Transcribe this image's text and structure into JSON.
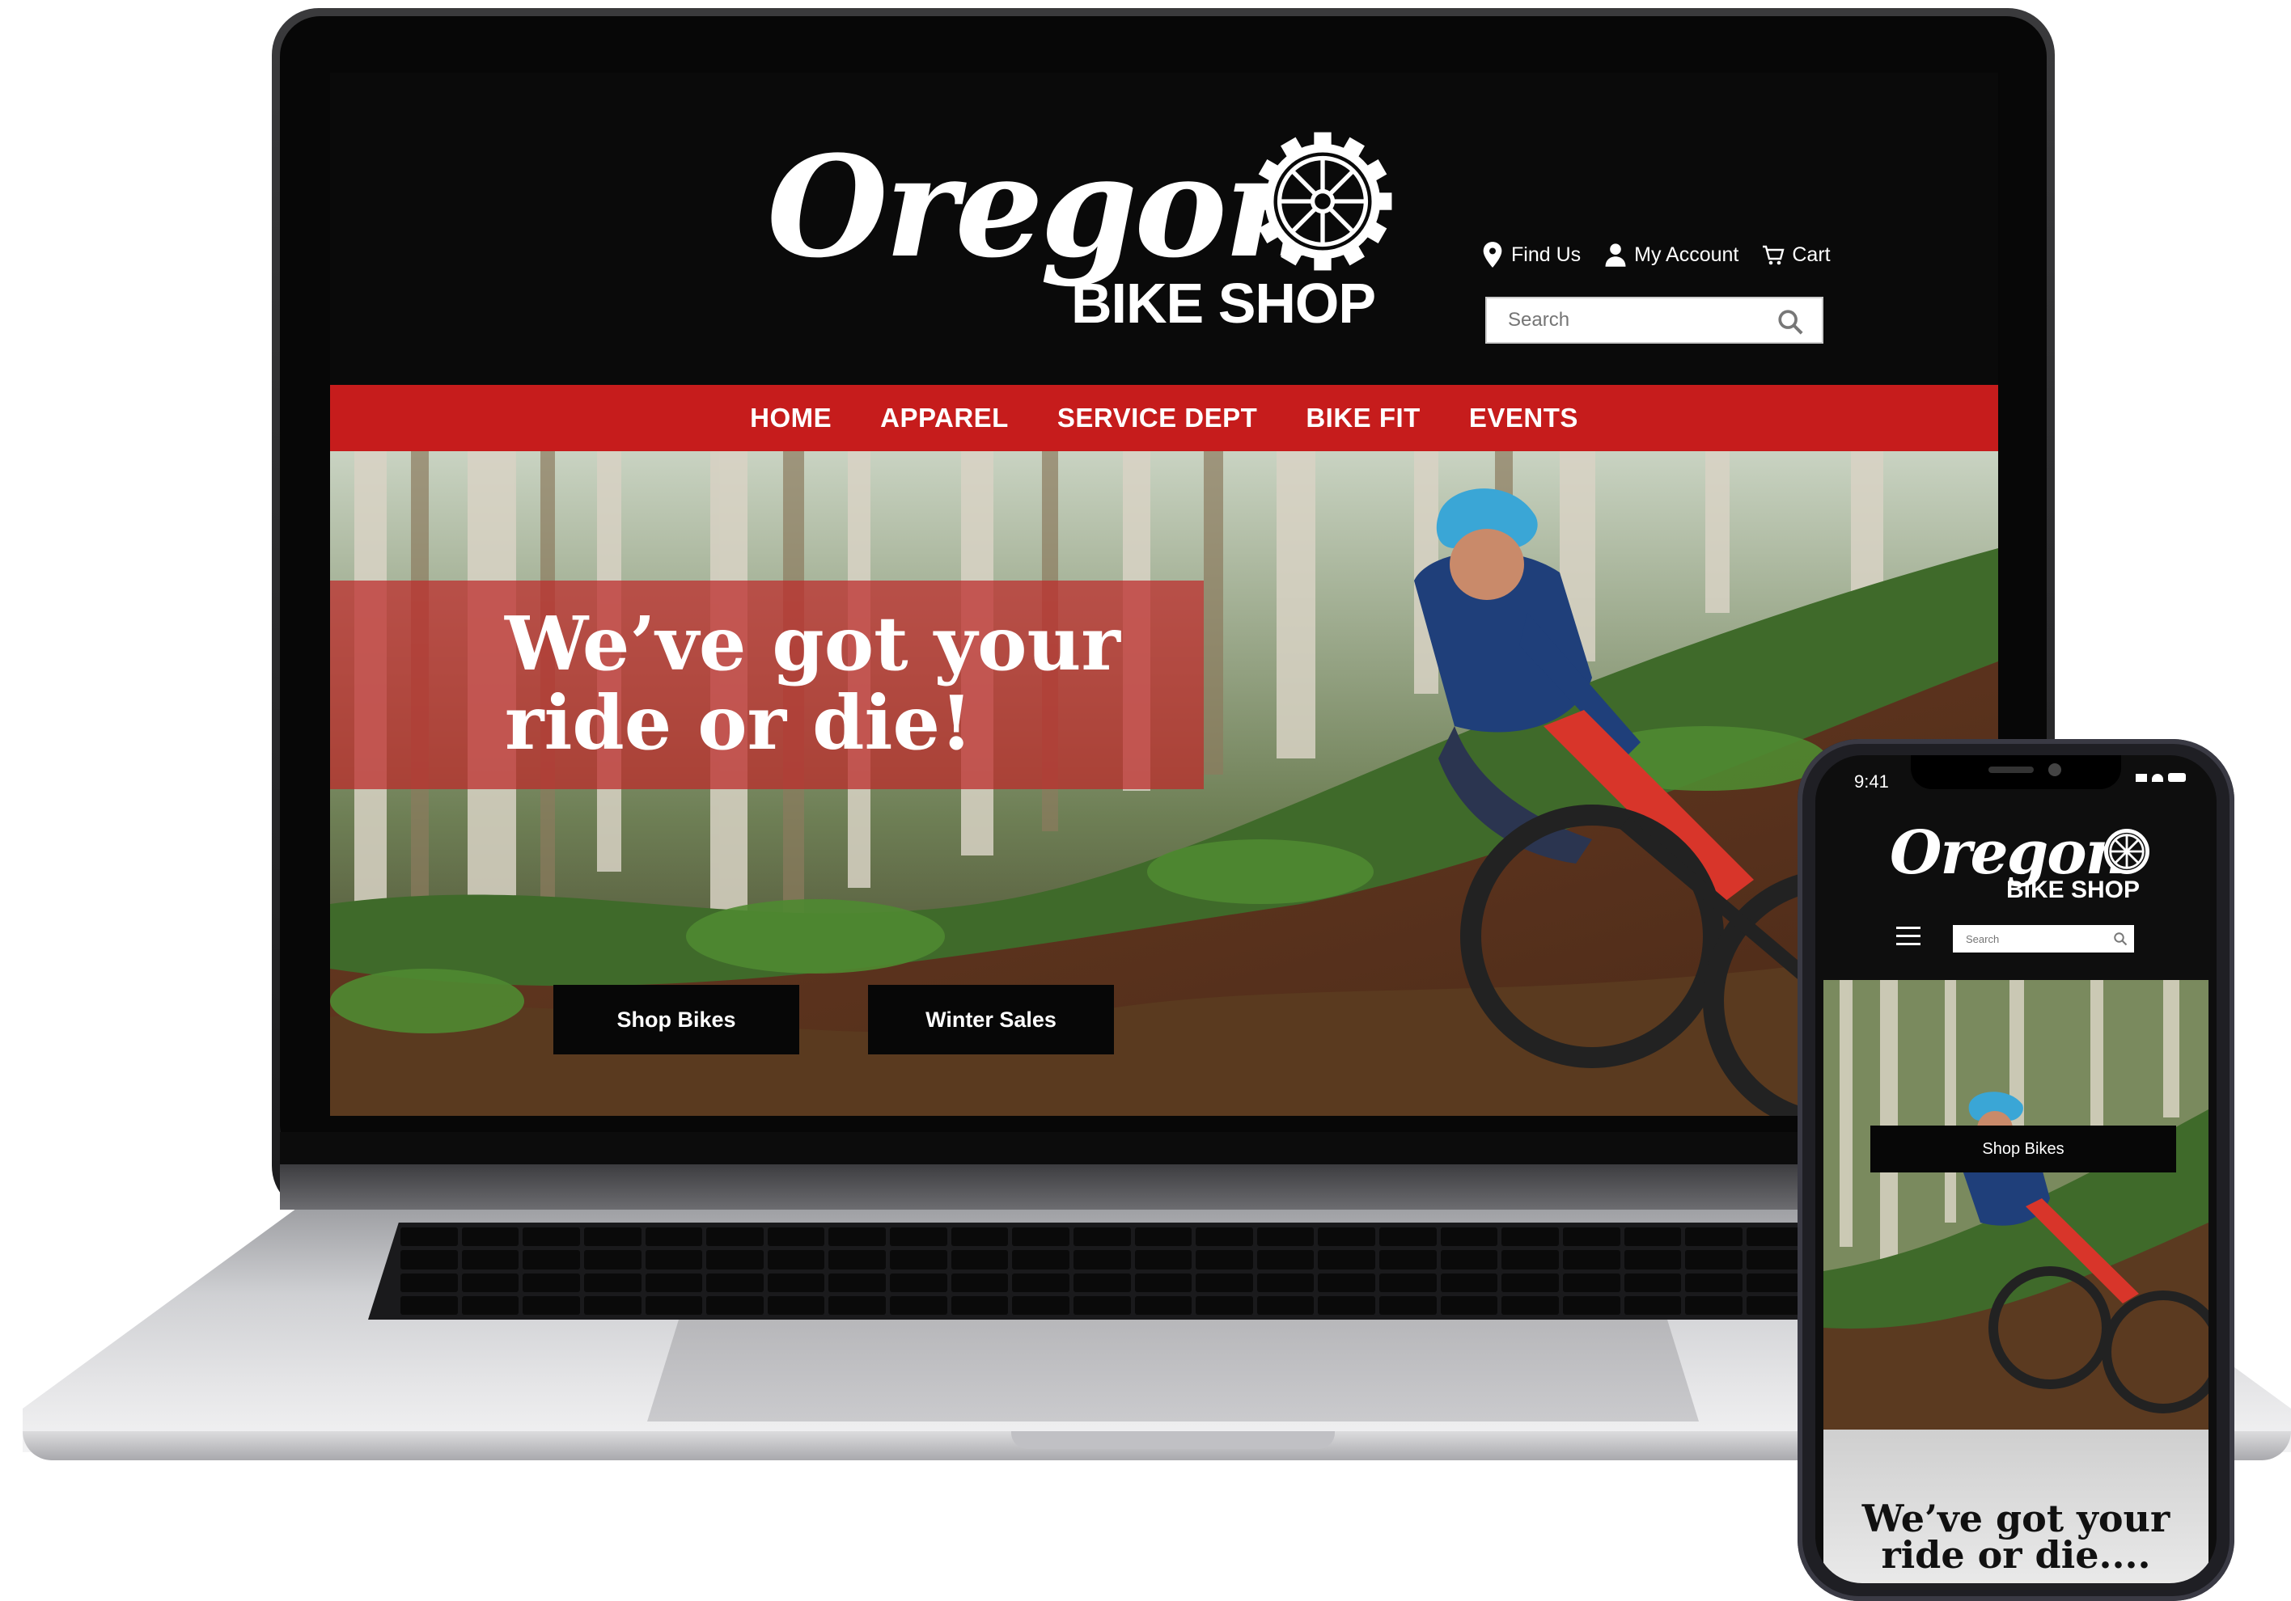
{
  "brand": {
    "name": "Oregon",
    "subtitle": "BIKE SHOP"
  },
  "header": {
    "find_us": "Find Us",
    "my_account": "My Account",
    "cart": "Cart",
    "search_placeholder": "Search"
  },
  "nav": {
    "items": [
      "HOME",
      "APPAREL",
      "SERVICE DEPT",
      "BIKE FIT",
      "EVENTS"
    ]
  },
  "hero": {
    "title_line1": "We’ve got your",
    "title_line2": "ride or die!",
    "primary_button": "Shop Bikes",
    "secondary_button": "Winter Sales"
  },
  "phone": {
    "time": "9:41",
    "search_placeholder": "Search",
    "button": "Shop Bikes",
    "tagline_line1": "We’ve got your",
    "tagline_line2": "ride or die...."
  },
  "colors": {
    "nav_red": "#c61c1c",
    "header_black": "#0a0a0a",
    "banner_red": "#be2828"
  }
}
